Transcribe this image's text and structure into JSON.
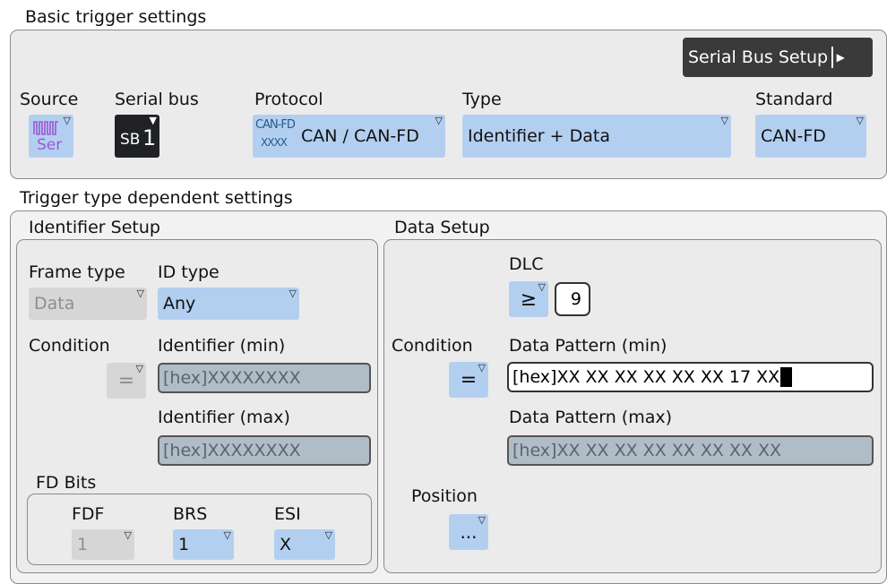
{
  "basic": {
    "title": "Basic trigger settings",
    "serial_bus_setup_label": "Serial Bus Setup",
    "source": {
      "label": "Source",
      "icon": "serial-source-icon",
      "icon_text": "Ser"
    },
    "serial_bus": {
      "label": "Serial bus",
      "value_prefix": "SB",
      "value_num": "1"
    },
    "protocol": {
      "label": "Protocol",
      "icon_line1": "CAN-FD",
      "icon_line2": "XXXX",
      "value": "CAN / CAN-FD"
    },
    "type": {
      "label": "Type",
      "value": "Identifier + Data"
    },
    "standard": {
      "label": "Standard",
      "value": "CAN-FD"
    }
  },
  "dependent": {
    "title": "Trigger type dependent settings",
    "identifier_setup": {
      "title": "Identifier Setup",
      "frame_type": {
        "label": "Frame type",
        "value": "Data",
        "enabled": false
      },
      "id_type": {
        "label": "ID type",
        "value": "Any"
      },
      "condition": {
        "label": "Condition",
        "value": "=",
        "enabled": false
      },
      "identifier_min": {
        "label": "Identifier (min)",
        "value": "[hex]XXXXXXXX"
      },
      "identifier_max": {
        "label": "Identifier (max)",
        "value": "[hex]XXXXXXXX"
      },
      "fd_bits": {
        "title": "FD Bits",
        "fdf": {
          "label": "FDF",
          "value": "1",
          "enabled": false
        },
        "brs": {
          "label": "BRS",
          "value": "1"
        },
        "esi": {
          "label": "ESI",
          "value": "X"
        }
      }
    },
    "data_setup": {
      "title": "Data Setup",
      "dlc": {
        "label": "DLC",
        "operator": "≥",
        "value": "9"
      },
      "condition": {
        "label": "Condition",
        "value": "="
      },
      "data_pattern_min": {
        "label": "Data Pattern (min)",
        "value": "[hex]XX XX XX XX XX XX 17 XX"
      },
      "data_pattern_max": {
        "label": "Data Pattern (max)",
        "value": "[hex]XX XX XX XX XX XX XX XX"
      },
      "position": {
        "label": "Position",
        "value": "..."
      }
    }
  },
  "colors": {
    "panel_bg": "#ebebeb",
    "control_blue": "#b3cff0",
    "field_gray": "#b0bcc6",
    "button_dark": "#3a3a3a"
  }
}
